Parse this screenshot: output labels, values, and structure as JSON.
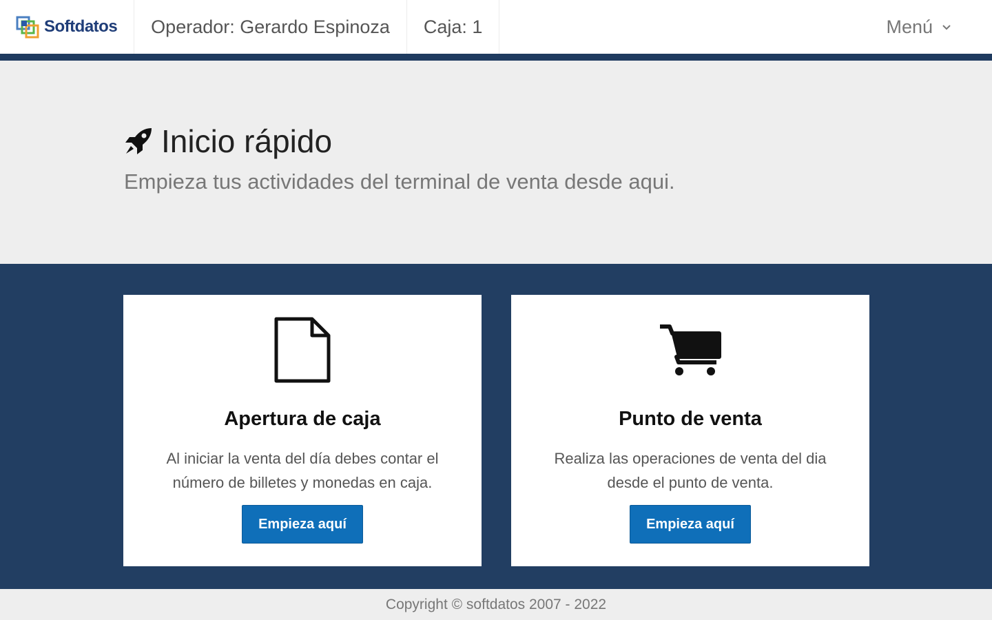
{
  "navbar": {
    "brand": "Softdatos",
    "operator": "Operador: Gerardo Espinoza",
    "caja": "Caja: 1",
    "menu": "Menú",
    "accent_color": "#1e3a5f"
  },
  "hero": {
    "icon": "rocket-icon",
    "title": "Inicio rápido",
    "subtitle": "Empieza tus actividades del terminal de venta desde aqui."
  },
  "cards": [
    {
      "icon": "file-icon",
      "title": "Apertura de caja",
      "text": "Al iniciar la venta del día debes contar el número de billetes y monedas en caja.",
      "button": "Empieza aquí"
    },
    {
      "icon": "shopping-cart-icon",
      "title": "Punto de venta",
      "text": "Realiza las operaciones de venta del dia desde el punto de venta.",
      "button": "Empieza aquí"
    }
  ],
  "colors": {
    "band": "#223e62",
    "button": "#0f6fb9"
  },
  "footer": {
    "copyright": "Copyright © softdatos 2007 - 2022"
  }
}
